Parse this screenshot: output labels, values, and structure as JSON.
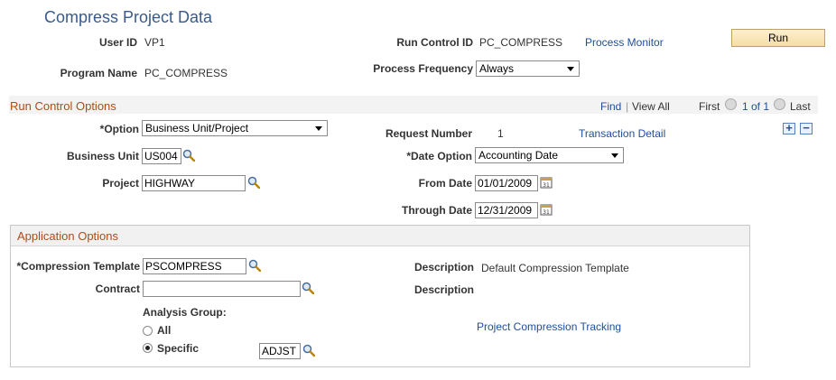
{
  "page": {
    "title": "Compress Project Data"
  },
  "header": {
    "user_id_label": "User ID",
    "user_id_value": "VP1",
    "run_control_label": "Run Control ID",
    "run_control_value": "PC_COMPRESS",
    "process_monitor": "Process Monitor",
    "run_button": "Run",
    "program_name_label": "Program Name",
    "program_name_value": "PC_COMPRESS",
    "process_frequency_label": "Process Frequency",
    "process_frequency_value": "Always"
  },
  "run_control_options": {
    "title": "Run Control Options",
    "find": "Find",
    "separator": "|",
    "view_all": "View All",
    "first": "First",
    "page_indicator": "1 of 1",
    "last": "Last",
    "option_label": "*Option",
    "option_value": "Business Unit/Project",
    "request_number_label": "Request Number",
    "request_number_value": "1",
    "transaction_detail": "Transaction Detail",
    "business_unit_label": "Business Unit",
    "business_unit_value": "US004",
    "date_option_label": "*Date Option",
    "date_option_value": "Accounting Date",
    "project_label": "Project",
    "project_value": "HIGHWAY",
    "from_date_label": "From Date",
    "from_date_value": "01/01/2009",
    "through_date_label": "Through Date",
    "through_date_value": "12/31/2009",
    "add_row": "+",
    "delete_row": "−"
  },
  "application_options": {
    "title": "Application Options",
    "compression_template_label": "*Compression Template",
    "compression_template_value": "PSCOMPRESS",
    "description_label_1": "Description",
    "description_value_1": "Default Compression Template",
    "contract_label": "Contract",
    "contract_value": "",
    "description_label_2": "Description",
    "analysis_group_label": "Analysis Group:",
    "radio_all": "All",
    "radio_specific": "Specific",
    "selected_radio": "Specific",
    "analysis_group_value": "ADJST",
    "tracking_link": "Project Compression Tracking"
  },
  "colors": {
    "title": "#3a5a8a",
    "section_title": "#b24a16",
    "link": "#1f4e99"
  },
  "icons": {
    "lookup": "magnifier-icon",
    "calendar": "calendar-icon"
  }
}
